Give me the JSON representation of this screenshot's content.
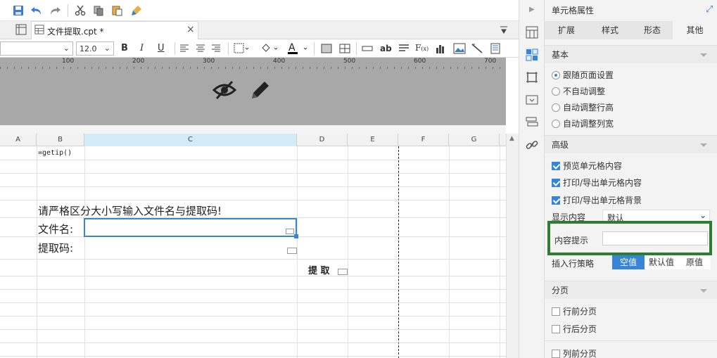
{
  "toolbar": {
    "file_tab_label": "文件提取.cpt *",
    "font_size": "12.0"
  },
  "ruler": {
    "labels": [
      "100",
      "200",
      "300",
      "400",
      "500",
      "600",
      "700"
    ]
  },
  "columns": [
    "A",
    "B",
    "C",
    "D",
    "E",
    "F",
    "G"
  ],
  "sheet": {
    "formula_cell": "=getip()",
    "instruction": "请严格区分大小写输入文件名与提取码!",
    "filename_label": "文件名:",
    "code_label": "提取码:",
    "extract_button": "提 取"
  },
  "panel": {
    "title": "单元格属性",
    "tabs": [
      "扩展",
      "样式",
      "形态",
      "其他"
    ],
    "active_tab": "其他",
    "basic": {
      "heading": "基本",
      "options": [
        "跟随页面设置",
        "不自动调整",
        "自动调整行高",
        "自动调整列宽"
      ],
      "selected": "跟随页面设置"
    },
    "advanced": {
      "heading": "高级",
      "checks": [
        "预览单元格内容",
        "打印/导出单元格内容",
        "打印/导出单元格背景"
      ],
      "display_label": "显示内容",
      "display_value": "默认",
      "tooltip_label": "内容提示",
      "tooltip_value": "",
      "insert_label": "插入行策略",
      "insert_options": [
        "空值",
        "默认值",
        "原值"
      ],
      "insert_selected": "空值"
    },
    "pagination": {
      "heading": "分页",
      "checks": [
        "行前分页",
        "行后分页",
        "列前分页"
      ]
    }
  },
  "colors": {
    "accent": "#3685d6",
    "highlight_box": "#2e7d32",
    "selected_column": "#d3ecf7"
  }
}
